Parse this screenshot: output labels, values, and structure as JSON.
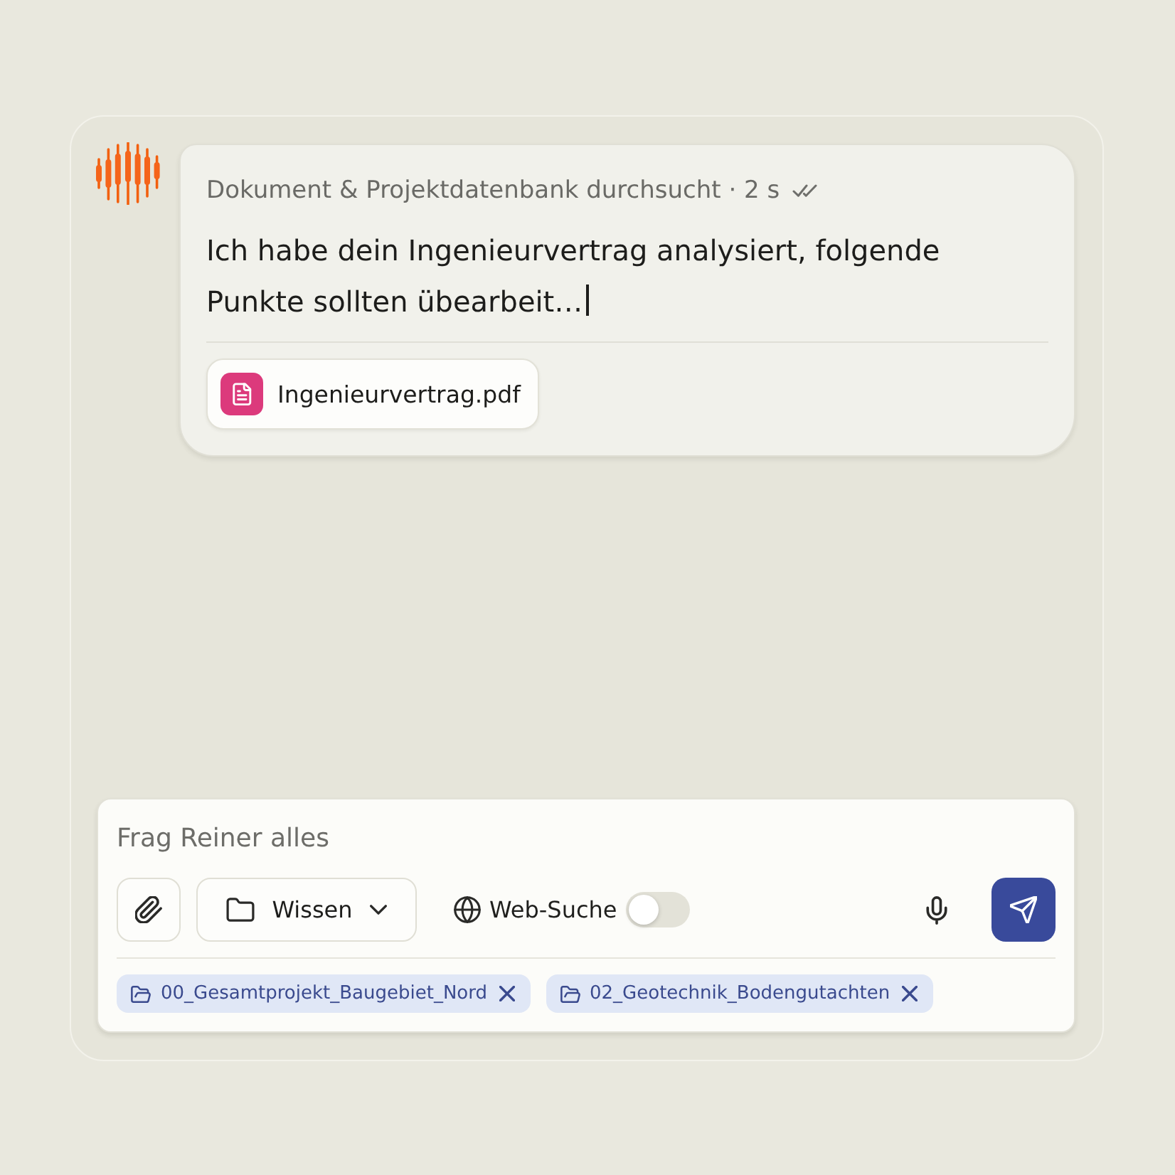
{
  "assistant_message": {
    "status": "Dokument & Projektdatenbank durchsucht · 2 s",
    "text": "Ich habe dein Ingenieurvertrag analysiert, folgende Punkte sollten übearbeit…",
    "typing_cursor": true,
    "attachments": [
      {
        "kind": "pdf",
        "name": "Ingenieurvertrag.pdf"
      }
    ]
  },
  "composer": {
    "placeholder": "Frag Reiner alles",
    "knowledge_button": {
      "label": "Wissen"
    },
    "web_search": {
      "label": "Web-Suche",
      "on": false
    },
    "selected_folders": [
      {
        "name": "00_Gesamtprojekt_Baugebiet_Nord"
      },
      {
        "name": "02_Geotechnik_Bodengutachten"
      }
    ]
  }
}
